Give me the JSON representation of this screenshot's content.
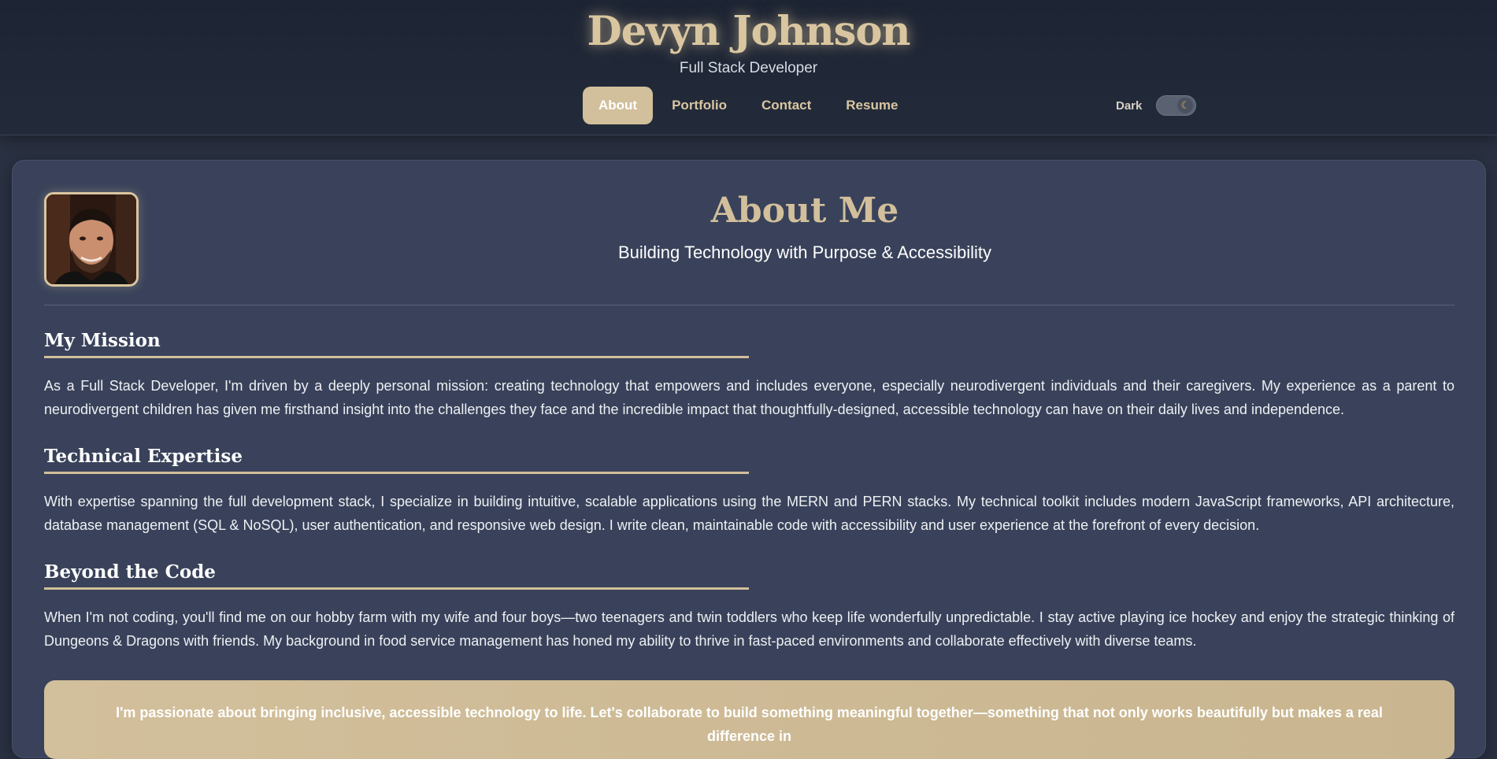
{
  "header": {
    "name": "Devyn Johnson",
    "role": "Full Stack Developer",
    "nav": [
      {
        "label": "About",
        "active": true
      },
      {
        "label": "Portfolio",
        "active": false
      },
      {
        "label": "Contact",
        "active": false
      },
      {
        "label": "Resume",
        "active": false
      }
    ],
    "theme": {
      "label": "Dark",
      "icon": "moon-icon",
      "enabled": true
    }
  },
  "about": {
    "title": "About Me",
    "subtitle": "Building Technology with Purpose & Accessibility",
    "avatar_alt": "profile-photo",
    "sections": [
      {
        "heading": "My Mission",
        "body": "As a Full Stack Developer, I'm driven by a deeply personal mission: creating technology that empowers and includes everyone, especially neurodivergent individuals and their caregivers. My experience as a parent to neurodivergent children has given me firsthand insight into the challenges they face and the incredible impact that thoughtfully-designed, accessible technology can have on their daily lives and independence."
      },
      {
        "heading": "Technical Expertise",
        "body": "With expertise spanning the full development stack, I specialize in building intuitive, scalable applications using the MERN and PERN stacks. My technical toolkit includes modern JavaScript frameworks, API architecture, database management (SQL & NoSQL), user authentication, and responsive web design. I write clean, maintainable code with accessibility and user experience at the forefront of every decision."
      },
      {
        "heading": "Beyond the Code",
        "body": "When I'm not coding, you'll find me on our hobby farm with my wife and four boys—two teenagers and twin toddlers who keep life wonderfully unpredictable. I stay active playing ice hockey and enjoy the strategic thinking of Dungeons & Dragons with friends. My background in food service management has honed my ability to thrive in fast-paced environments and collaborate effectively with diverse teams."
      }
    ],
    "cta": "I'm passionate about bringing inclusive, accessible technology to life. Let's collaborate to build something meaningful together—something that not only works beautifully but makes a real difference in"
  },
  "colors": {
    "accent": "#d2bf9b",
    "header_bg": "#1d2433",
    "card_bg": "#39425a"
  }
}
